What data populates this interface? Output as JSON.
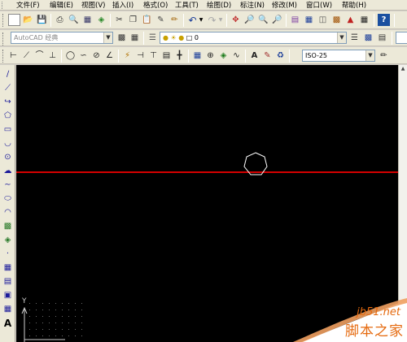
{
  "menu": {
    "items": [
      "文件(F)",
      "编辑(E)",
      "视图(V)",
      "插入(I)",
      "格式(O)",
      "工具(T)",
      "绘图(D)",
      "标注(N)",
      "修改(M)",
      "窗口(W)",
      "帮助(H)"
    ]
  },
  "toolbar2": {
    "workspace_value": "AutoCAD 经典",
    "layer_value": "0"
  },
  "toolbar3": {
    "dimstyle_value": "ISO-25"
  },
  "ucs": {
    "y_label": "Y"
  },
  "watermark": {
    "site": "jb51.net",
    "text": "脚本之家"
  },
  "colors": {
    "canvas": "#000000",
    "crosshair": "#d40000",
    "watermark": "#e56a0f"
  }
}
